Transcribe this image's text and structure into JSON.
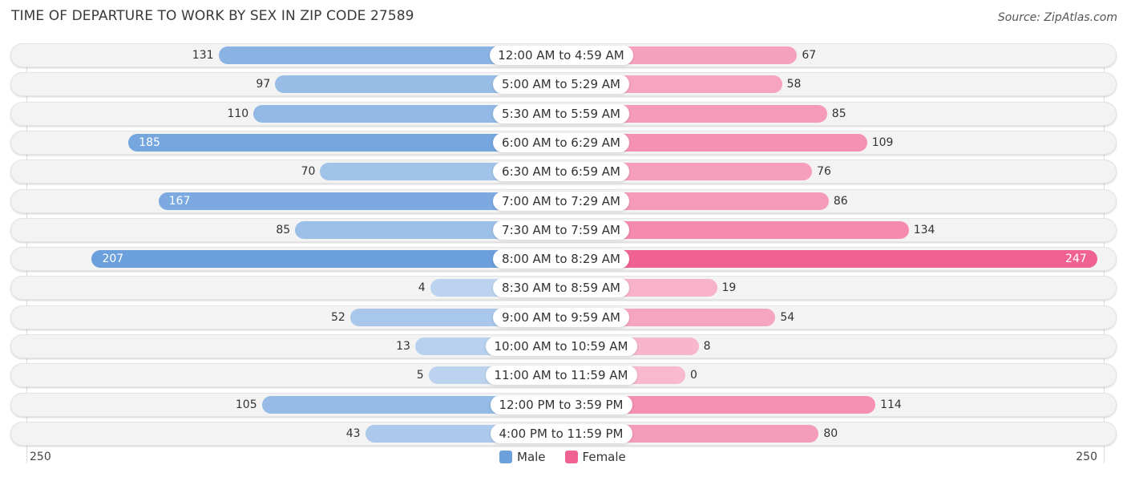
{
  "chart_data": {
    "type": "bar",
    "orientation": "horizontal-diverging",
    "title": "TIME OF DEPARTURE TO WORK BY SEX IN ZIP CODE 27589",
    "source": "Source: ZipAtlas.com",
    "categories": [
      "12:00 AM to 4:59 AM",
      "5:00 AM to 5:29 AM",
      "5:30 AM to 5:59 AM",
      "6:00 AM to 6:29 AM",
      "6:30 AM to 6:59 AM",
      "7:00 AM to 7:29 AM",
      "7:30 AM to 7:59 AM",
      "8:00 AM to 8:29 AM",
      "8:30 AM to 8:59 AM",
      "9:00 AM to 9:59 AM",
      "10:00 AM to 10:59 AM",
      "11:00 AM to 11:59 AM",
      "12:00 PM to 3:59 PM",
      "4:00 PM to 11:59 PM"
    ],
    "series": [
      {
        "name": "Male",
        "color": "#6ca0dc",
        "values": [
          131,
          97,
          110,
          185,
          70,
          167,
          85,
          207,
          4,
          52,
          13,
          5,
          105,
          43
        ]
      },
      {
        "name": "Female",
        "color": "#f06292",
        "values": [
          67,
          58,
          85,
          109,
          76,
          86,
          134,
          247,
          19,
          54,
          8,
          0,
          114,
          80
        ]
      }
    ],
    "axis": {
      "left_label": "250",
      "right_label": "250",
      "max": 250
    },
    "legend": {
      "position": "bottom-center",
      "items": [
        "Male",
        "Female"
      ]
    },
    "grid": false
  }
}
